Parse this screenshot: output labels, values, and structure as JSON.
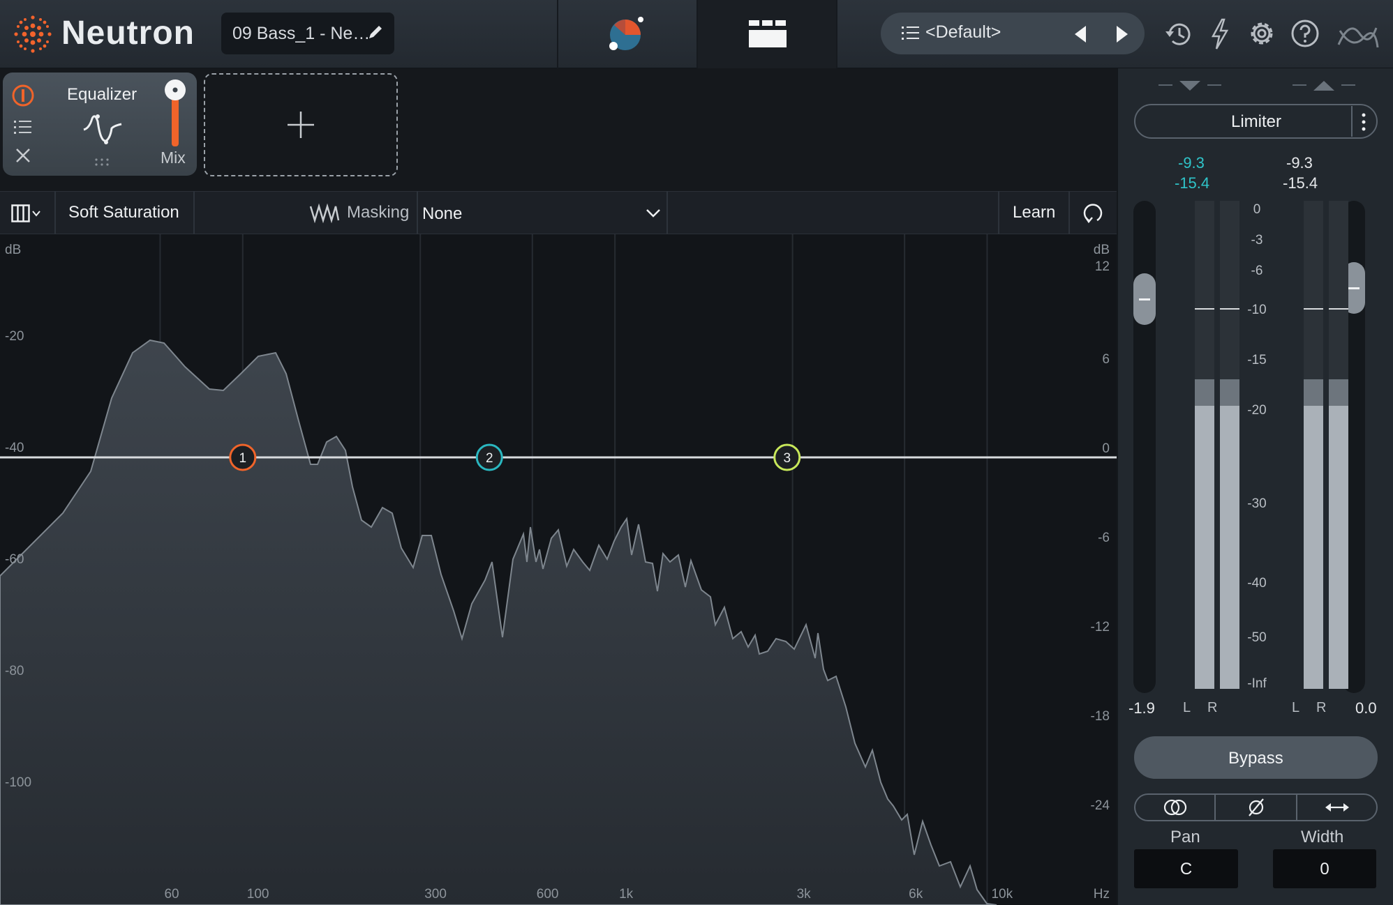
{
  "app": {
    "name": "Neutron",
    "track_title": "09 Bass_1 - Ne…"
  },
  "preset": {
    "name": "<Default>"
  },
  "modules": [
    {
      "name": "Equalizer",
      "mix_label": "Mix"
    }
  ],
  "toolbar": {
    "saturation": "Soft Saturation",
    "masking_label": "Masking",
    "masking_value": "None",
    "learn": "Learn"
  },
  "graph": {
    "left_db_unit": "dB",
    "right_db_unit": "dB",
    "hz_unit": "Hz",
    "left_db_ticks": [
      "-20",
      "-40",
      "-60",
      "-80",
      "-100"
    ],
    "right_db_ticks": [
      "12",
      "6",
      "0",
      "-6",
      "-12",
      "-18",
      "-24"
    ],
    "freq_ticks": [
      "60",
      "100",
      "300",
      "600",
      "1k",
      "3k",
      "6k",
      "10k"
    ],
    "nodes": [
      {
        "label": "1",
        "color": "#f0642a",
        "freq_hz": 100
      },
      {
        "label": "2",
        "color": "#2ab7c0",
        "freq_hz": 460
      },
      {
        "label": "3",
        "color": "#c8e85a",
        "freq_hz": 2900
      }
    ]
  },
  "meters": {
    "module": "Limiter",
    "input": {
      "peak": "-9.3",
      "rms": "-15.4",
      "gain": "-1.9",
      "accent": "#2fc4c9",
      "fill": 0.58
    },
    "output": {
      "peak": "-9.3",
      "rms": "-15.4",
      "gain": "0.0",
      "accent": "#e6e8eb",
      "fill": 0.58
    },
    "scale": [
      "0",
      "-3",
      "-6",
      "-10",
      "-15",
      "-20",
      "-30",
      "-40",
      "-50",
      "-Inf"
    ],
    "channel_left": "L",
    "channel_right": "R",
    "bypass": "Bypass",
    "pan_label": "Pan",
    "pan_value": "C",
    "width_label": "Width",
    "width_value": "0"
  },
  "icons": [
    "neutron-logo-icon",
    "pencil-icon",
    "visual-mixer-icon",
    "module-grid-icon",
    "list-icon",
    "prev-arrow-icon",
    "next-arrow-icon",
    "history-icon",
    "lightning-icon",
    "gear-icon",
    "help-icon",
    "izotope-logo-icon",
    "power-icon",
    "close-icon",
    "plus-icon",
    "columns-icon",
    "masking-icon",
    "chevron-down-icon",
    "loop-icon",
    "stereo-link-icon",
    "phase-icon",
    "swap-icon"
  ]
}
